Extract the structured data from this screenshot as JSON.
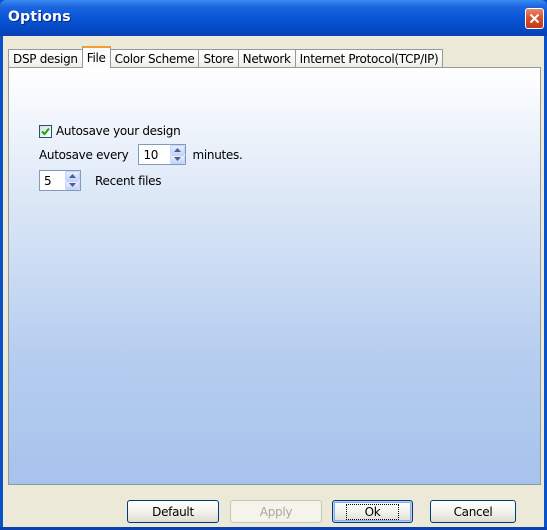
{
  "window": {
    "title": "Options"
  },
  "tabs": [
    {
      "label": "DSP design",
      "selected": false
    },
    {
      "label": "File",
      "selected": true
    },
    {
      "label": "Color Scheme",
      "selected": false
    },
    {
      "label": "Store",
      "selected": false
    },
    {
      "label": "Network",
      "selected": false
    },
    {
      "label": "Internet Protocol(TCP/IP)",
      "selected": false
    }
  ],
  "file_tab": {
    "autosave_checkbox_label": "Autosave your design",
    "autosave_checked": true,
    "autosave_prefix": "Autosave every",
    "autosave_interval": "10",
    "autosave_suffix": "minutes.",
    "recent_files_count": "5",
    "recent_files_label": "Recent files"
  },
  "buttons": {
    "default": "Default",
    "apply": "Apply",
    "ok": "Ok",
    "cancel": "Cancel"
  },
  "colors": {
    "titlebar": "#0a55d8",
    "selected_tab_accent": "#f0a030",
    "close_button": "#d8502c",
    "checkmark": "#21a121"
  },
  "icons": {
    "close": "close-icon",
    "check": "checkmark-icon",
    "spin_up": "spin-up-icon",
    "spin_down": "spin-down-icon"
  }
}
